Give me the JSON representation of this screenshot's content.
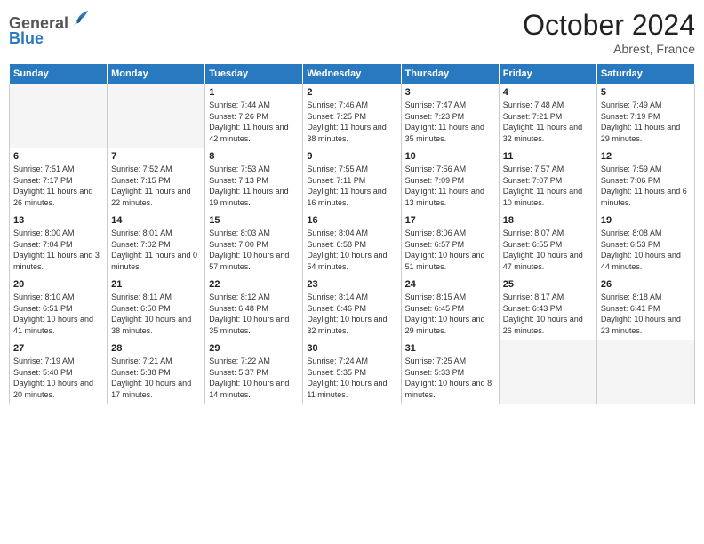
{
  "header": {
    "logo_line1": "General",
    "logo_line2": "Blue",
    "month_title": "October 2024",
    "subtitle": "Abrest, France"
  },
  "days_of_week": [
    "Sunday",
    "Monday",
    "Tuesday",
    "Wednesday",
    "Thursday",
    "Friday",
    "Saturday"
  ],
  "weeks": [
    [
      {
        "day": "",
        "info": ""
      },
      {
        "day": "",
        "info": ""
      },
      {
        "day": "1",
        "info": "Sunrise: 7:44 AM\nSunset: 7:26 PM\nDaylight: 11 hours and 42 minutes."
      },
      {
        "day": "2",
        "info": "Sunrise: 7:46 AM\nSunset: 7:25 PM\nDaylight: 11 hours and 38 minutes."
      },
      {
        "day": "3",
        "info": "Sunrise: 7:47 AM\nSunset: 7:23 PM\nDaylight: 11 hours and 35 minutes."
      },
      {
        "day": "4",
        "info": "Sunrise: 7:48 AM\nSunset: 7:21 PM\nDaylight: 11 hours and 32 minutes."
      },
      {
        "day": "5",
        "info": "Sunrise: 7:49 AM\nSunset: 7:19 PM\nDaylight: 11 hours and 29 minutes."
      }
    ],
    [
      {
        "day": "6",
        "info": "Sunrise: 7:51 AM\nSunset: 7:17 PM\nDaylight: 11 hours and 26 minutes."
      },
      {
        "day": "7",
        "info": "Sunrise: 7:52 AM\nSunset: 7:15 PM\nDaylight: 11 hours and 22 minutes."
      },
      {
        "day": "8",
        "info": "Sunrise: 7:53 AM\nSunset: 7:13 PM\nDaylight: 11 hours and 19 minutes."
      },
      {
        "day": "9",
        "info": "Sunrise: 7:55 AM\nSunset: 7:11 PM\nDaylight: 11 hours and 16 minutes."
      },
      {
        "day": "10",
        "info": "Sunrise: 7:56 AM\nSunset: 7:09 PM\nDaylight: 11 hours and 13 minutes."
      },
      {
        "day": "11",
        "info": "Sunrise: 7:57 AM\nSunset: 7:07 PM\nDaylight: 11 hours and 10 minutes."
      },
      {
        "day": "12",
        "info": "Sunrise: 7:59 AM\nSunset: 7:06 PM\nDaylight: 11 hours and 6 minutes."
      }
    ],
    [
      {
        "day": "13",
        "info": "Sunrise: 8:00 AM\nSunset: 7:04 PM\nDaylight: 11 hours and 3 minutes."
      },
      {
        "day": "14",
        "info": "Sunrise: 8:01 AM\nSunset: 7:02 PM\nDaylight: 11 hours and 0 minutes."
      },
      {
        "day": "15",
        "info": "Sunrise: 8:03 AM\nSunset: 7:00 PM\nDaylight: 10 hours and 57 minutes."
      },
      {
        "day": "16",
        "info": "Sunrise: 8:04 AM\nSunset: 6:58 PM\nDaylight: 10 hours and 54 minutes."
      },
      {
        "day": "17",
        "info": "Sunrise: 8:06 AM\nSunset: 6:57 PM\nDaylight: 10 hours and 51 minutes."
      },
      {
        "day": "18",
        "info": "Sunrise: 8:07 AM\nSunset: 6:55 PM\nDaylight: 10 hours and 47 minutes."
      },
      {
        "day": "19",
        "info": "Sunrise: 8:08 AM\nSunset: 6:53 PM\nDaylight: 10 hours and 44 minutes."
      }
    ],
    [
      {
        "day": "20",
        "info": "Sunrise: 8:10 AM\nSunset: 6:51 PM\nDaylight: 10 hours and 41 minutes."
      },
      {
        "day": "21",
        "info": "Sunrise: 8:11 AM\nSunset: 6:50 PM\nDaylight: 10 hours and 38 minutes."
      },
      {
        "day": "22",
        "info": "Sunrise: 8:12 AM\nSunset: 6:48 PM\nDaylight: 10 hours and 35 minutes."
      },
      {
        "day": "23",
        "info": "Sunrise: 8:14 AM\nSunset: 6:46 PM\nDaylight: 10 hours and 32 minutes."
      },
      {
        "day": "24",
        "info": "Sunrise: 8:15 AM\nSunset: 6:45 PM\nDaylight: 10 hours and 29 minutes."
      },
      {
        "day": "25",
        "info": "Sunrise: 8:17 AM\nSunset: 6:43 PM\nDaylight: 10 hours and 26 minutes."
      },
      {
        "day": "26",
        "info": "Sunrise: 8:18 AM\nSunset: 6:41 PM\nDaylight: 10 hours and 23 minutes."
      }
    ],
    [
      {
        "day": "27",
        "info": "Sunrise: 7:19 AM\nSunset: 5:40 PM\nDaylight: 10 hours and 20 minutes."
      },
      {
        "day": "28",
        "info": "Sunrise: 7:21 AM\nSunset: 5:38 PM\nDaylight: 10 hours and 17 minutes."
      },
      {
        "day": "29",
        "info": "Sunrise: 7:22 AM\nSunset: 5:37 PM\nDaylight: 10 hours and 14 minutes."
      },
      {
        "day": "30",
        "info": "Sunrise: 7:24 AM\nSunset: 5:35 PM\nDaylight: 10 hours and 11 minutes."
      },
      {
        "day": "31",
        "info": "Sunrise: 7:25 AM\nSunset: 5:33 PM\nDaylight: 10 hours and 8 minutes."
      },
      {
        "day": "",
        "info": ""
      },
      {
        "day": "",
        "info": ""
      }
    ]
  ]
}
